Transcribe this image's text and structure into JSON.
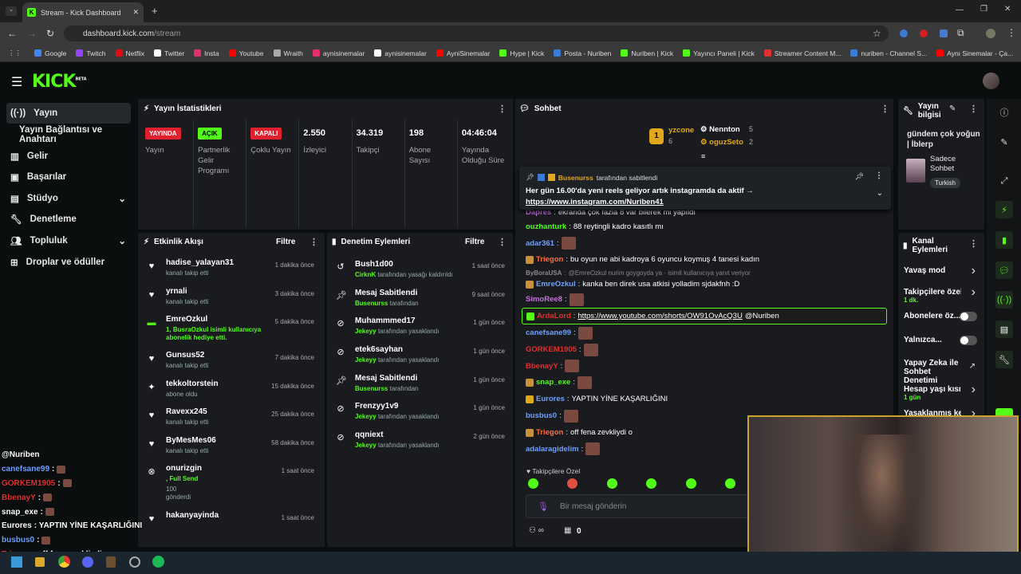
{
  "browser": {
    "tab_title": "Stream - Kick Dashboard",
    "url_host": "dashboard.kick.com",
    "url_path": "/stream",
    "bookmarks": [
      "Google",
      "Twitch",
      "Netflix",
      "Twitter",
      "Insta",
      "Youtube",
      "Wraith",
      "aynisinemalar",
      "aynisinemalar",
      "AyniSinemalar",
      "Hype | Kick",
      "Posta - Nuriben",
      "Nuriben | Kick",
      "Yayıncı Paneli | Kick",
      "Streamer Content M...",
      "nuriben - Channel S...",
      "Aynı Sinemalar - Ça..."
    ]
  },
  "app": {
    "logo": "KICK",
    "beta": "BETA"
  },
  "sidebar": {
    "items": [
      {
        "label": "Yayın"
      },
      {
        "label": "Yayın Bağlantısı ve Anahtarı"
      },
      {
        "label": "Gelir"
      },
      {
        "label": "Başarılar"
      },
      {
        "label": "Stüdyo"
      },
      {
        "label": "Denetleme"
      },
      {
        "label": "Topluluk"
      },
      {
        "label": "Droplar ve ödüller"
      }
    ]
  },
  "stats": {
    "title": "Yayın İstatistikleri",
    "cols": [
      {
        "tag": "YAYINDA",
        "label": "Yayın"
      },
      {
        "tag": "AÇIK",
        "label": "Partnerlik Gelir Programı"
      },
      {
        "tag": "KAPALI",
        "label": "Çoklu Yayın"
      },
      {
        "value": "2.550",
        "label": "İzleyici"
      },
      {
        "value": "34.319",
        "label": "Takipçi"
      },
      {
        "value": "198",
        "label": "Abone Sayısı"
      },
      {
        "value": "04:46:04",
        "label": "Yayında Olduğu Süre"
      }
    ]
  },
  "activity": {
    "title": "Etkinlik Akışı",
    "filter": "Filtre",
    "events": [
      {
        "name": "hadise_yalayan31",
        "sub": "kanalı takip etti",
        "time": "1 dakika önce"
      },
      {
        "name": "yrnali",
        "sub": "kanalı takip etti",
        "time": "3 dakika önce"
      },
      {
        "name": "EmreOzkul",
        "sub": "1, BusraOzkul isimli kullanıcıya abonelik hediye etti.",
        "time": "5 dakika önce"
      },
      {
        "name": "Gunsus52",
        "sub": "kanalı takip etti",
        "time": "7 dakika önce"
      },
      {
        "name": "tekkoltorstein",
        "sub": "abone oldu",
        "time": "15 dakika önce"
      },
      {
        "name": "Ravexx245",
        "sub": "kanalı takip etti",
        "time": "25 dakika önce"
      },
      {
        "name": "ByMesMes06",
        "sub": "kanalı takip etti",
        "time": "58 dakika önce"
      },
      {
        "name": "onurizgin",
        "sub": ", Full Send",
        "extra": "100 gönderdi",
        "time": "1 saat önce"
      },
      {
        "name": "hakanyayinda",
        "sub": "",
        "time": "1 saat önce"
      }
    ]
  },
  "moderation": {
    "title": "Denetim Eylemleri",
    "filter": "Filtre",
    "events": [
      {
        "name": "Bush1d00",
        "actor": "CirknK",
        "action": "tarafından yasağı kaldırıldı",
        "time": "1 saat önce"
      },
      {
        "name": "Mesaj Sabitlendi",
        "actor": "Busenurss",
        "action": "tarafından",
        "time": "9 saat önce"
      },
      {
        "name": "Muhammmed17",
        "actor": "Jekeyy",
        "action": "tarafından yasaklandı",
        "time": "1 gün önce"
      },
      {
        "name": "etek6sayhan",
        "actor": "Jekeyy",
        "action": "tarafından yasaklandı",
        "time": "1 gün önce"
      },
      {
        "name": "Mesaj Sabitlendi",
        "actor": "Busenurss",
        "action": "tarafından",
        "time": "1 gün önce"
      },
      {
        "name": "Frenzyy1v9",
        "actor": "Jekeyy",
        "action": "tarafından yasaklandı",
        "time": "1 gün önce"
      },
      {
        "name": "qqniext",
        "actor": "Jekeyy",
        "action": "tarafından yasaklandı",
        "time": "2 gün önce"
      }
    ]
  },
  "chat": {
    "title": "Sohbet",
    "top": [
      {
        "name": "yzcone",
        "count": "6"
      },
      {
        "name": "Nennton",
        "count": "5"
      },
      {
        "name": "oguzSeto",
        "count": "2"
      }
    ],
    "pinned_by": "Busenurss",
    "pinned_by_suffix": "tarafından sabitlendi",
    "pinned_text": "Her gün 16.00'da yeni reels geliyor artık instagramda da aktif →",
    "pinned_link": "https://www.instagram.com/Nuriben41",
    "messages": [
      {
        "user": "Dapres",
        "text": "ekranda çok fazla 8 var bilerek mi yapıldı",
        "color": "#c86fe0"
      },
      {
        "user": "ouzhanturk",
        "text": "88 reytingli kadro kasıtlı mı",
        "color": "#53fc18"
      },
      {
        "user": "adar361",
        "text": "",
        "color": "#6fa0ff"
      },
      {
        "user": "Triegon",
        "text": "bu oyun ne abi kadroya 6 oyuncu koymuş 4 tanesi kadın",
        "color": "#ff6b3d"
      },
      {
        "user": "ByBoraUSA",
        "text": "@EmreOzkul nurim goygoyda ya · isimli kullanıcıya yanıt veriyor",
        "color": "#888"
      },
      {
        "user": "EmreOzkul",
        "text": "kanka ben direk usa atkisi yolladim sjdakfnh :D",
        "color": "#6fa0ff"
      },
      {
        "user": "SimoRee8",
        "text": "",
        "color": "#c86fe0"
      },
      {
        "user": "ArdaLord",
        "text": "https://www.youtube.com/shorts/OW91OvAcQ3U",
        "suffix": "@Nuriben",
        "color": "#e03030"
      },
      {
        "user": "canefsane99",
        "text": "",
        "color": "#6fa0ff"
      },
      {
        "user": "GORKEM1905",
        "text": "",
        "color": "#e03030"
      },
      {
        "user": "BbenayY",
        "text": "",
        "color": "#e03030"
      },
      {
        "user": "snap_exe",
        "text": "",
        "color": "#53fc18"
      },
      {
        "user": "Eurores",
        "text": "YAPTIN YİNE KAŞARLIĞINI",
        "color": "#6fa0ff"
      },
      {
        "user": "busbus0",
        "text": "",
        "color": "#6fa0ff"
      },
      {
        "user": "Triegon",
        "text": "off fena zevkliydi o",
        "color": "#ff6b3d"
      },
      {
        "user": "adalaragidelim",
        "text": "",
        "color": "#6fa0ff"
      }
    ],
    "followers_only": "Takipçilere Özel",
    "input_placeholder": "Bir mesaj gönderin",
    "count": "0"
  },
  "stream_info": {
    "title": "Yayın bilgisi",
    "stream_title": "gündem çok yoğun | İblerp",
    "mode": "Sadece Sohbet",
    "language": "Turkish"
  },
  "channel_actions": {
    "title": "Kanal Eylemleri",
    "rows": [
      {
        "label": "Yavaş mod"
      },
      {
        "label": "Takipçilere özel s...",
        "sub": "1 dk."
      },
      {
        "label": "Abonelere öz..."
      },
      {
        "label": "Yalnızca..."
      },
      {
        "label": "Yapay Zeka ile Sohbet Denetimi"
      },
      {
        "label": "Hesap yaşı kısıtla",
        "sub": "1 gün"
      },
      {
        "label": "Yasaklanmış kelin..."
      }
    ]
  },
  "overlay": {
    "lines": [
      {
        "user": "@Nuriben",
        "text": ""
      },
      {
        "user": "canefsane99",
        "text": ":"
      },
      {
        "user": "GORKEM1905",
        "text": ":"
      },
      {
        "user": "BbenayY",
        "text": ":"
      },
      {
        "user": "snap_exe",
        "text": ":"
      },
      {
        "user": "Eurores",
        "text": ": YAPTIN YİNE KAŞARLIĞINI"
      },
      {
        "user": "busbus0",
        "text": ":"
      },
      {
        "user": "Triegon",
        "text": ": off fena zevkliydi o"
      }
    ]
  }
}
